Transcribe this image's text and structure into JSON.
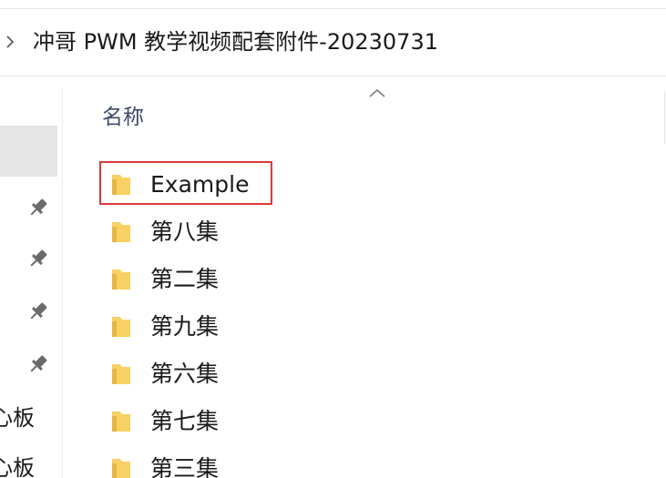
{
  "address_bar": {
    "breadcrumb": "冲哥 PWM 教学视频配套附件-20230731"
  },
  "nav_pane": {
    "pinned_items": [
      "pin-icon",
      "pin-icon",
      "pin-icon",
      "pin-icon"
    ],
    "labels": [
      "心板",
      "心板"
    ]
  },
  "file_list": {
    "column_header": "名称",
    "sort_direction": "ascending",
    "items": [
      {
        "name": "Example",
        "icon": "folder-icon",
        "highlighted": true
      },
      {
        "name": "第八集",
        "icon": "folder-icon"
      },
      {
        "name": "第二集",
        "icon": "folder-icon"
      },
      {
        "name": "第九集",
        "icon": "folder-icon"
      },
      {
        "name": "第六集",
        "icon": "folder-icon"
      },
      {
        "name": "第七集",
        "icon": "folder-icon"
      },
      {
        "name": "第三集",
        "icon": "folder-icon"
      }
    ]
  },
  "colors": {
    "highlight_border": "#d93a3a",
    "folder_yellow": "#f8d063",
    "header_text": "#3f4a6b",
    "selection_bg": "#e5e5e5"
  }
}
